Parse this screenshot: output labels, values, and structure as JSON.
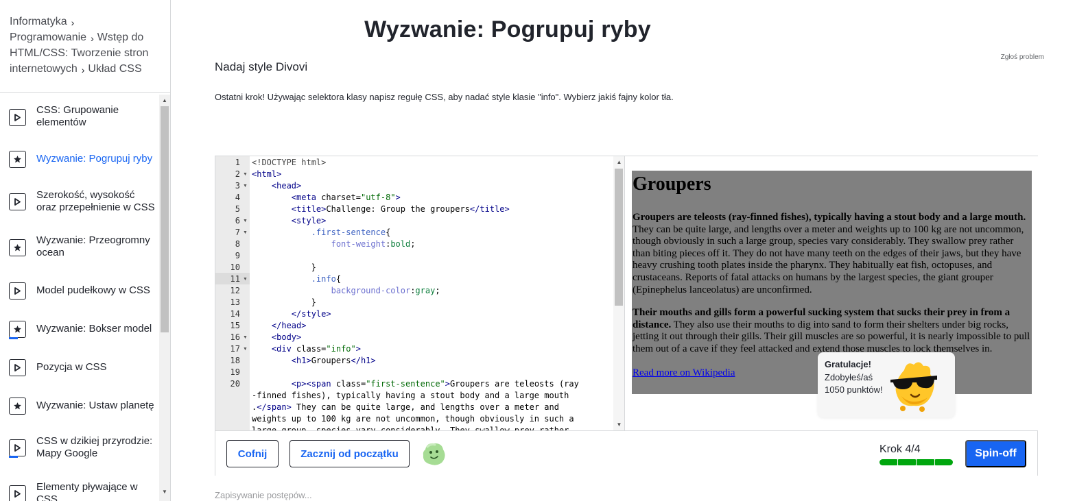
{
  "breadcrumb": {
    "items": [
      "Informatyka",
      "Programowanie",
      "Wstęp do HTML/CSS: Tworzenie stron internetowych",
      "Układ CSS"
    ]
  },
  "sidebar": {
    "items": [
      {
        "label": "CSS: Grupowanie elementów",
        "icon": "play-icon",
        "active": false,
        "progress": false
      },
      {
        "label": "Wyzwanie: Pogrupuj ryby",
        "icon": "star-icon",
        "active": true,
        "progress": false
      },
      {
        "label": "Szerokość, wysokość oraz przepełnienie w CSS",
        "icon": "play-icon",
        "active": false,
        "progress": false
      },
      {
        "label": "Wyzwanie: Przeogromny ocean",
        "icon": "star-icon",
        "active": false,
        "progress": false
      },
      {
        "label": "Model pudełkowy w CSS",
        "icon": "play-icon",
        "active": false,
        "progress": false
      },
      {
        "label": "Wyzwanie: Bokser model",
        "icon": "star-icon",
        "active": false,
        "progress": true
      },
      {
        "label": "Pozycja w CSS",
        "icon": "play-icon",
        "active": false,
        "progress": false
      },
      {
        "label": "Wyzwanie: Ustaw planetę",
        "icon": "star-icon",
        "active": false,
        "progress": false
      },
      {
        "label": "CSS w dzikiej przyrodzie: Mapy Google",
        "icon": "play-icon",
        "active": false,
        "progress": true
      },
      {
        "label": "Elementy pływające w CSS",
        "icon": "play-icon",
        "active": false,
        "progress": false
      }
    ]
  },
  "header": {
    "title": "Wyzwanie: Pogrupuj ryby",
    "report": "Zgłoś problem"
  },
  "step": {
    "title": "Nadaj style Divovi",
    "description": "Ostatni krok! Używając selektora klasy napisz regułę CSS, aby nadać style klasie \"info\". Wybierz jakiś fajny kolor tła."
  },
  "editor": {
    "line_numbers": [
      "1",
      "2",
      "3",
      "4",
      "5",
      "6",
      "7",
      "8",
      "9",
      "10",
      "11",
      "12",
      "13",
      "14",
      "15",
      "16",
      "17",
      "18",
      "19",
      "20"
    ],
    "active_line": 11,
    "fold_lines": [
      2,
      3,
      6,
      7,
      11,
      16,
      17
    ]
  },
  "preview": {
    "heading": "Groupers",
    "p1_bold": "Groupers are teleosts (ray-finned fishes), typically having a stout body and a large mouth.",
    "p1_rest": " They can be quite large, and lengths over a meter and weights up to 100 kg are not uncommon, though obviously in such a large group, species vary considerably. They swallow prey rather than biting pieces off it. They do not have many teeth on the edges of their jaws, but they have heavy crushing tooth plates inside the pharynx. They habitually eat fish, octopuses, and crustaceans. Reports of fatal attacks on humans by the largest species, the giant grouper (Epinephelus lanceolatus) are unconfirmed.",
    "p2_bold": "Their mouths and gills form a powerful sucking system that sucks their prey in from a distance.",
    "p2_rest": " They also use their mouths to dig into sand to form their shelters under big rocks, jetting it out through their gills. Their gill muscles are so powerful, it is nearly impossible to pull them out of a cave if they feel attacked and extend those muscles to lock themselves in.",
    "link": "Read more on Wikipedia",
    "background_color": "#808080"
  },
  "toast": {
    "title": "Gratulacje!",
    "body": "Zdobyłeś/aś 1050 punktów!"
  },
  "bottom": {
    "back_label": "Cofnij",
    "restart_label": "Zacznij od początku",
    "step_label": "Krok 4/4",
    "steps_total": 4,
    "steps_done": 4,
    "spinoff_label": "Spin-off"
  },
  "status": {
    "saving": "Zapisywanie postępów..."
  },
  "colors": {
    "accent": "#1865f2",
    "progress": "#00a60e",
    "text": "#21242c"
  }
}
